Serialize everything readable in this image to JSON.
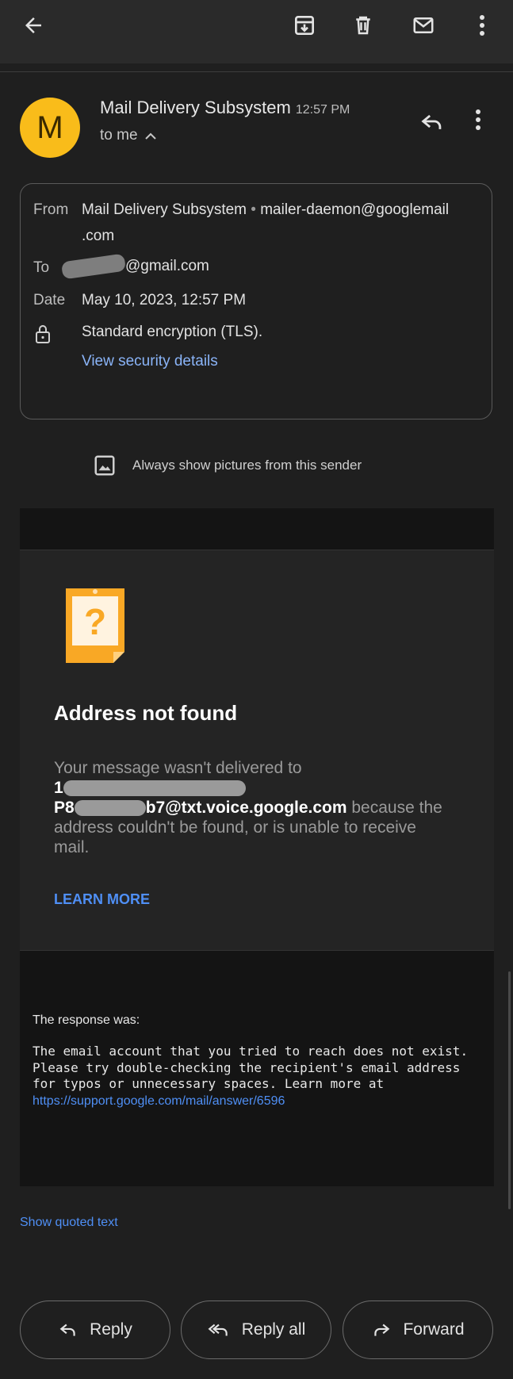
{
  "toolbar": {
    "back_icon": "arrow-left-icon",
    "archive_icon": "archive-icon",
    "delete_icon": "trash-icon",
    "mark_unread_icon": "mail-icon",
    "more_icon": "more-vert-icon"
  },
  "header": {
    "avatar_letter": "M",
    "avatar_color": "#f9bc1a",
    "sender": "Mail Delivery Subsystem",
    "time": "12:57 PM",
    "to": "to me"
  },
  "details": {
    "from_label": "From",
    "from_name": "Mail Delivery Subsystem",
    "from_email": "mailer-daemon@googlemail",
    "from_email_cont": ".com",
    "to_label": "To",
    "to_domain": "@gmail.com",
    "date_label": "Date",
    "date_value": "May 10, 2023, 12:57 PM",
    "encryption": "Standard encryption (TLS).",
    "security_link": "View security details"
  },
  "show_pictures": "Always show pictures from this sender",
  "bounce": {
    "title": "Address not found",
    "intro": "Your message wasn't delivered to",
    "address_start": "P8",
    "address_end": "b7@txt.voice.google.com",
    "reason": " because the address couldn't be found, or is unable to receive mail.",
    "learn_more": "LEARN MORE"
  },
  "response": {
    "label": "The response was:",
    "text": "The email account that you tried to reach does not exist. Please try double-checking the recipient's email address for typos or unnecessary spaces. Learn more at ",
    "url": "https://support.google.com/mail/answer/6596"
  },
  "show_quoted": "Show quoted text",
  "actions": {
    "reply": "Reply",
    "reply_all": "Reply all",
    "forward": "Forward"
  },
  "colors": {
    "accent_link": "#4f8ff5",
    "security_link": "#8ab4f8",
    "note_orange": "#f9a825"
  }
}
